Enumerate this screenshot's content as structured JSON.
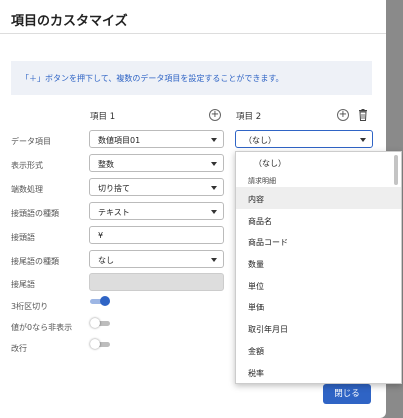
{
  "dialog": {
    "title": "項目のカスタマイズ",
    "info": "「＋」ボタンを押下して、複数のデータ項目を設定することができます。",
    "close_label": "閉じる"
  },
  "columns": {
    "col1": "項目 1",
    "col2": "項目 2"
  },
  "rows": {
    "data_item": "データ項目",
    "format": "表示形式",
    "rounding": "端数処理",
    "prefix_type": "接頭語の種類",
    "prefix": "接頭語",
    "suffix_type": "接尾語の種類",
    "suffix": "接尾語",
    "thousands": "3桁区切り",
    "hide_zero": "値が0なら非表示",
    "newline": "改行"
  },
  "item1": {
    "data_item": "数値項目01",
    "format": "整数",
    "rounding": "切り捨て",
    "prefix_type": "テキスト",
    "prefix": "¥",
    "suffix_type": "なし",
    "suffix": "",
    "thousands_on": true,
    "hide_zero_on": false,
    "newline_on": false
  },
  "item2": {
    "data_item": "（なし）"
  },
  "dropdown": {
    "items": [
      "（なし）",
      "請求明細",
      "内容",
      "商品名",
      "商品コード",
      "数量",
      "単位",
      "単価",
      "取引年月日",
      "金額",
      "税率"
    ]
  },
  "icons": {
    "add": "plus-circle-icon",
    "delete": "trash-icon",
    "caret": "chevron-down-icon"
  },
  "colors": {
    "accent": "#2f64c5",
    "info_bg": "#eef1f7"
  }
}
